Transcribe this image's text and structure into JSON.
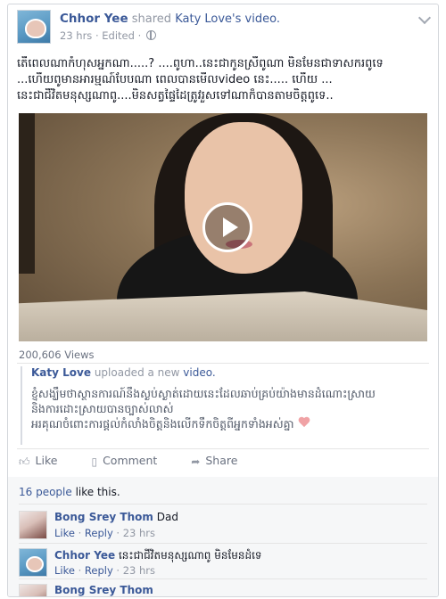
{
  "post": {
    "author": "Chhor Yee",
    "shared_text": "shared",
    "shared_owner": "Katy Love's",
    "shared_object": "video.",
    "timestamp": "23 hrs",
    "edited": "Edited",
    "meta_sep": "·",
    "text_lines": [
      "តើពេលណាកំហុសអ្នកណា.....? ....ពូហា..នេះជាកូនស្រីពូណា មិនមែនជាទាសករពូទេ",
      "...ហើយពូមានអារម្មណ៍បែបណា ពេលបានមើលvideo នេះ..... ហើយ ...",
      "នេះជាជីវិតមនុស្សណាពូ....មិនសត្វផ្ទៃដៃត្រូវរួសទៅណាក៏បានតាមចិត្តពូទេ.."
    ],
    "views": "200,606 Views"
  },
  "shared": {
    "uploader": "Katy Love",
    "uploaded_text": "uploaded a new",
    "uploaded_object": "video.",
    "desc_lines": [
      "ខ្ញុំសង្ឃឹមថាស្ថានការណ៍នឹងស្ងប់ស្ងាត់ដោយនេះដែលឆាប់គ្រប់យ៉ាងមានដំណោះស្រាយ",
      "និងការដោះស្រាយបានច្បាស់លាស់",
      "អរគុណចំពោះការផ្តល់កំលាំងចិត្តនិងលើកទឹកចិត្តពីអ្នកទាំងអស់គ្នា"
    ]
  },
  "actions": {
    "like": "Like",
    "comment": "Comment",
    "share": "Share"
  },
  "ufi": {
    "likes_count": "16 people",
    "likes_suffix": "like this."
  },
  "comments": [
    {
      "author": "Bong Srey Thom",
      "text": "Dad",
      "like": "Like",
      "reply": "Reply",
      "time": "23 hrs"
    },
    {
      "author": "Chhor Yee",
      "text": "នេះជាជីវិតមនុស្សណាពូ មិនមែនដំទេ",
      "like": "Like",
      "reply": "Reply",
      "time": "23 hrs"
    },
    {
      "author": "Bong Srey Thom",
      "text": "",
      "like": "",
      "reply": "",
      "time": ""
    }
  ],
  "icons": {
    "globe": "globe-icon",
    "chevron": "chevron-down-icon",
    "play": "play-icon",
    "heart": "heart-icon",
    "like": "thumbs-up-icon",
    "comment": "comment-icon",
    "share": "share-arrow-icon"
  },
  "colors": {
    "link": "#3b5998",
    "muted": "#9197a3",
    "heart": "#f0a2a5"
  }
}
